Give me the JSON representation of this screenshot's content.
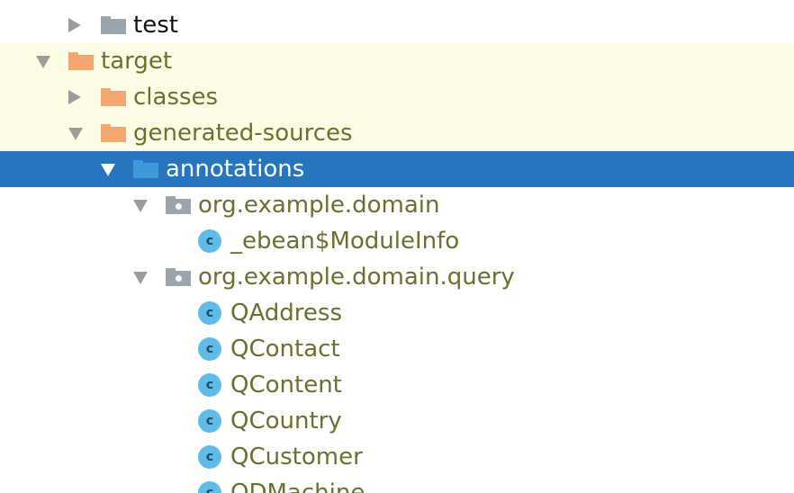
{
  "tree": {
    "test": "test",
    "target": "target",
    "classes": "classes",
    "generated_sources": "generated-sources",
    "annotations": "annotations",
    "pkg_domain": "org.example.domain",
    "module_info": "_ebean$ModuleInfo",
    "pkg_query": "org.example.domain.query",
    "class_icon_letter": "c",
    "classes_list": [
      "QAddress",
      "QContact",
      "QContent",
      "QCountry",
      "QCustomer",
      "QDMachine"
    ]
  },
  "colors": {
    "selection": "#2675bf",
    "excluded_background": "#fdfde6",
    "excluded_text": "#6e6e2e",
    "orange_folder": "#f3a66f",
    "blue_folder": "#3c9ad8",
    "class_icon": "#5fbce6"
  }
}
